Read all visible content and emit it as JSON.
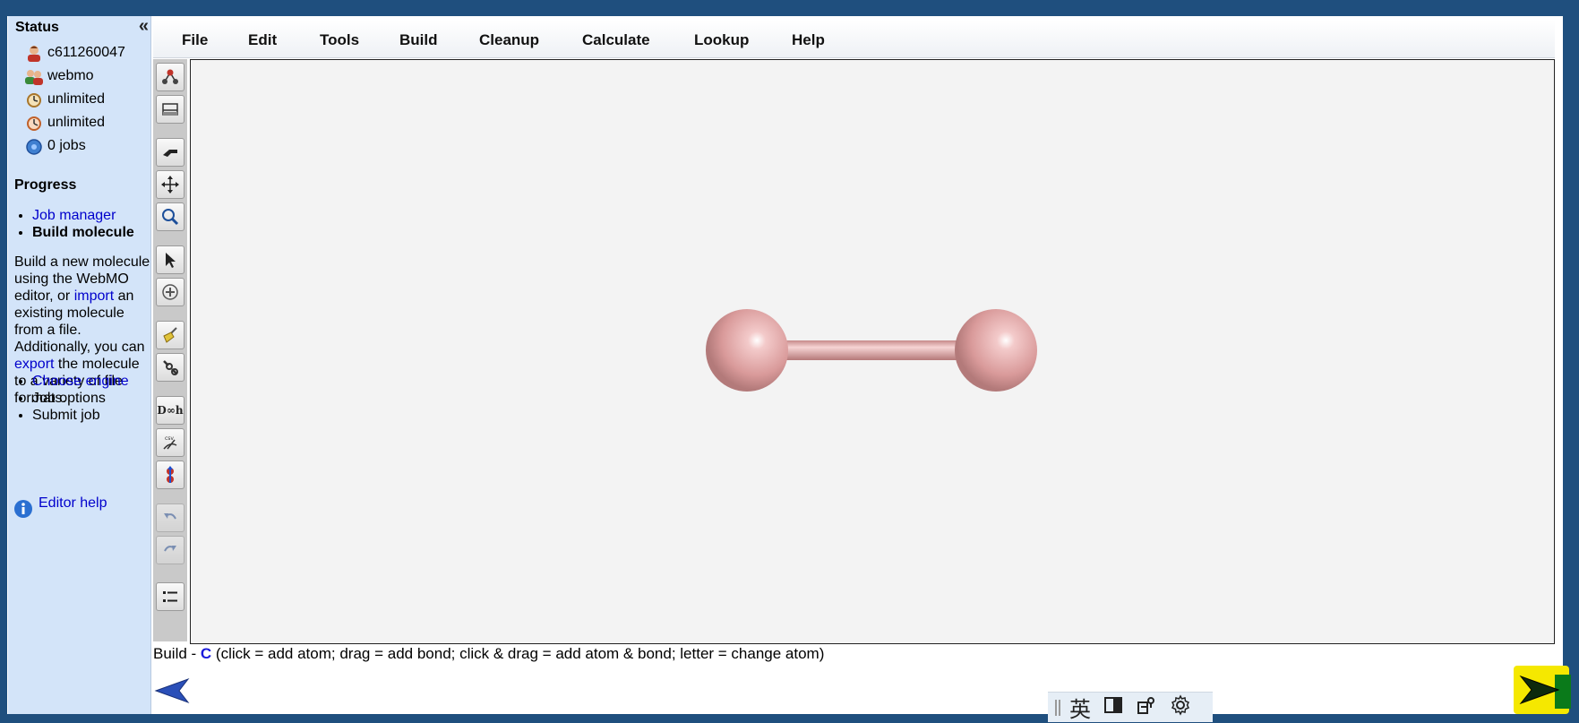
{
  "sidebar": {
    "title": "Status",
    "collapse_label": "«",
    "status": [
      {
        "icon": "user-icon",
        "text": "c611260047"
      },
      {
        "icon": "group-icon",
        "text": "webmo"
      },
      {
        "icon": "time-limit-icon",
        "text": "unlimited"
      },
      {
        "icon": "clock-icon",
        "text": "unlimited"
      },
      {
        "icon": "jobs-icon",
        "text": "0 jobs"
      }
    ],
    "progress_title": "Progress",
    "steps_top": [
      {
        "label": "Job manager",
        "link": true
      },
      {
        "label": "Build molecule",
        "link": false,
        "current": true
      }
    ],
    "description": {
      "part1": "Build a new molecule using the WebMO editor, or ",
      "import_link": "import",
      "part2": " an existing molecule from a file. Additionally, you can ",
      "export_link": "export",
      "part3": " the molecule to a variety of file formats."
    },
    "steps_bottom": [
      {
        "label": "Choose engine",
        "link": true
      },
      {
        "label": "Job options",
        "link": false
      },
      {
        "label": "Submit job",
        "link": false
      }
    ],
    "help_label": "Editor help"
  },
  "menu": [
    "File",
    "Edit",
    "Tools",
    "Build",
    "Cleanup",
    "Calculate",
    "Lookup",
    "Help"
  ],
  "toolbar": [
    {
      "name": "atom-bond-tool-icon"
    },
    {
      "name": "fragment-tool-icon"
    },
    {
      "name": "rotate-tool-icon"
    },
    {
      "name": "translate-tool-icon"
    },
    {
      "name": "zoom-tool-icon"
    },
    {
      "name": "select-tool-icon"
    },
    {
      "name": "add-hydrogen-tool-icon"
    },
    {
      "name": "cleanup-broom-icon"
    },
    {
      "name": "adjust-wrench-icon"
    },
    {
      "name": "symmetry-tool-icon",
      "text": "D∞h"
    },
    {
      "name": "cleanup-tool-icon"
    },
    {
      "name": "dipole-tool-icon"
    },
    {
      "name": "undo-icon",
      "disabled": true
    },
    {
      "name": "redo-icon",
      "disabled": true
    },
    {
      "name": "list-icon"
    }
  ],
  "status_line": {
    "prefix": "Build - ",
    "element": "C",
    "hint": " (click = add atom; drag = add bond; click & drag = add atom & bond; letter = change atom)"
  },
  "ime": {
    "lang": "英"
  },
  "colors": {
    "background": "#1f4f7e",
    "sidebar": "#d3e4f9",
    "canvas": "#f3f3f3",
    "atom": "#d99a9a",
    "link": "#0000cc",
    "next_highlight": "#f5e800"
  }
}
